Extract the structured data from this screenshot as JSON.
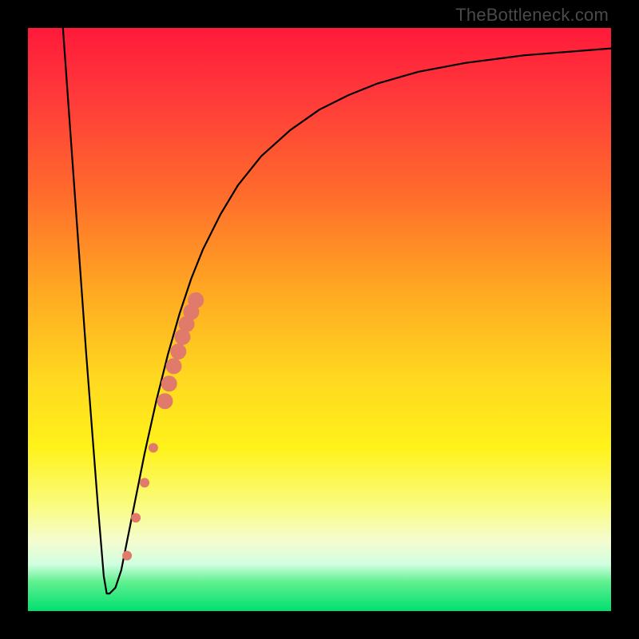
{
  "watermark": "TheBottleneck.com",
  "chart_data": {
    "type": "line",
    "title": "",
    "xlabel": "",
    "ylabel": "",
    "xlim": [
      0,
      100
    ],
    "ylim": [
      0,
      100
    ],
    "curve": {
      "x": [
        6,
        8,
        10,
        12,
        13,
        13.5,
        14,
        15,
        16,
        17,
        18,
        20,
        22,
        24,
        26,
        28,
        30,
        33,
        36,
        40,
        45,
        50,
        55,
        60,
        67,
        75,
        85,
        100
      ],
      "y": [
        100,
        72,
        44,
        18,
        6,
        3,
        3,
        4,
        7,
        12,
        17,
        27,
        36,
        44,
        51,
        57,
        62,
        68,
        73,
        78,
        82.5,
        86,
        88.5,
        90.5,
        92.5,
        94,
        95.3,
        96.5
      ]
    },
    "flat_segment": {
      "x": [
        13,
        15
      ],
      "y": 3
    },
    "dots": {
      "comment": "salmon dots along the ascending branch",
      "points": [
        {
          "x": 17.0,
          "y": 9.5,
          "r": 6
        },
        {
          "x": 18.5,
          "y": 16.0,
          "r": 6
        },
        {
          "x": 20.0,
          "y": 22.0,
          "r": 6
        },
        {
          "x": 21.5,
          "y": 28.0,
          "r": 6
        },
        {
          "x": 23.5,
          "y": 36.0,
          "r": 10
        },
        {
          "x": 24.2,
          "y": 39.0,
          "r": 10
        },
        {
          "x": 25.0,
          "y": 42.0,
          "r": 10
        },
        {
          "x": 25.8,
          "y": 44.5,
          "r": 10
        },
        {
          "x": 26.5,
          "y": 47.0,
          "r": 10
        },
        {
          "x": 27.2,
          "y": 49.2,
          "r": 10
        },
        {
          "x": 28.0,
          "y": 51.3,
          "r": 10
        },
        {
          "x": 28.8,
          "y": 53.3,
          "r": 10
        }
      ],
      "color": "#e07a6a"
    }
  }
}
